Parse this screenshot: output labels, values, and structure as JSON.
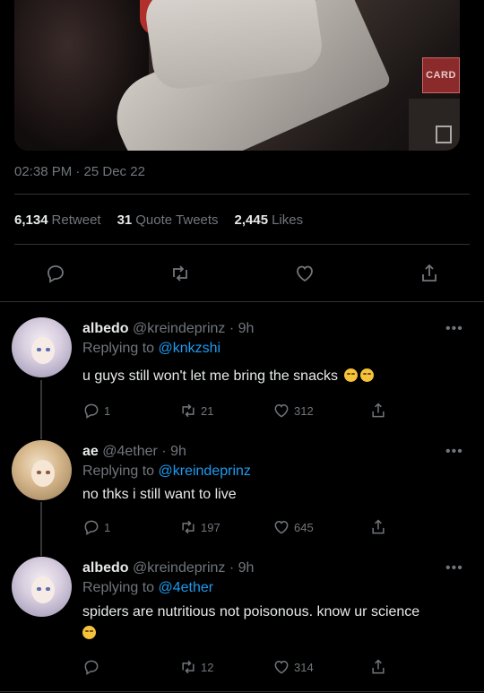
{
  "tweet": {
    "media": {
      "sign_text": "CARD"
    },
    "timestamp": "02:38 PM · 25 Dec 22",
    "stats": [
      {
        "count": "6,134",
        "label": "Retweet"
      },
      {
        "count": "31",
        "label": "Quote Tweets"
      },
      {
        "count": "2,445",
        "label": "Likes"
      }
    ]
  },
  "replies": [
    {
      "name": "albedo",
      "handle": "@kreindeprinz",
      "time": "· 9h",
      "replying_prefix": "Replying to",
      "replying_to": "@knkzshi",
      "text": "u guys still won't let me bring the snacks",
      "emoji": [
        "unamused-face",
        "unamused-face"
      ],
      "replies": "1",
      "retweets": "21",
      "likes": "312",
      "more": "•••"
    },
    {
      "name": "ae",
      "handle": "@4ether",
      "time": "· 9h",
      "replying_prefix": "Replying to",
      "replying_to": "@kreindeprinz",
      "text": "no thks i still want to live",
      "replies": "1",
      "retweets": "197",
      "likes": "645",
      "more": "•••"
    },
    {
      "name": "albedo",
      "handle": "@kreindeprinz",
      "time": "· 9h",
      "replying_prefix": "Replying to",
      "replying_to": "@4ether",
      "text": "spiders are nutritious not poisonous. know ur science",
      "emoji": [
        "face-with-rolling-eyes"
      ],
      "replies": "",
      "retweets": "12",
      "likes": "314",
      "more": "•••"
    }
  ],
  "colors": {
    "background": "#000000",
    "text": "#e7e9ea",
    "muted": "#71767b",
    "link": "#1d9bf0",
    "divider": "#2f3336"
  }
}
